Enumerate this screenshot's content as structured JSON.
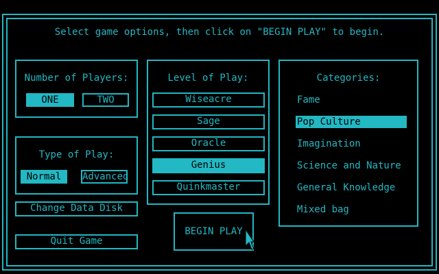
{
  "instruction": "Select game options, then click on \"BEGIN PLAY\" to begin.",
  "players": {
    "title": "Number of Players:",
    "options": [
      "ONE",
      "TWO"
    ],
    "selected": "ONE"
  },
  "type_of_play": {
    "title": "Type of Play:",
    "options": [
      "Normal",
      "Advanced"
    ],
    "selected": "Normal"
  },
  "level": {
    "title": "Level of Play:",
    "options": [
      "Wiseacre",
      "Sage",
      "Oracle",
      "Genius",
      "Quinkmaster"
    ],
    "selected": "Genius"
  },
  "categories": {
    "title": "Categories:",
    "items": [
      "Fame",
      "Pop Culture",
      "Imagination",
      "Science and Nature",
      "General Knowledge",
      "Mixed bag"
    ],
    "selected": "Pop Culture"
  },
  "buttons": {
    "change_disk": "Change Data Disk",
    "quit": "Quit Game",
    "begin": "BEGIN PLAY"
  },
  "colors": {
    "foreground": "#22b8c4",
    "background": "#000000"
  },
  "cursor_icon": "arrow-cursor-icon"
}
